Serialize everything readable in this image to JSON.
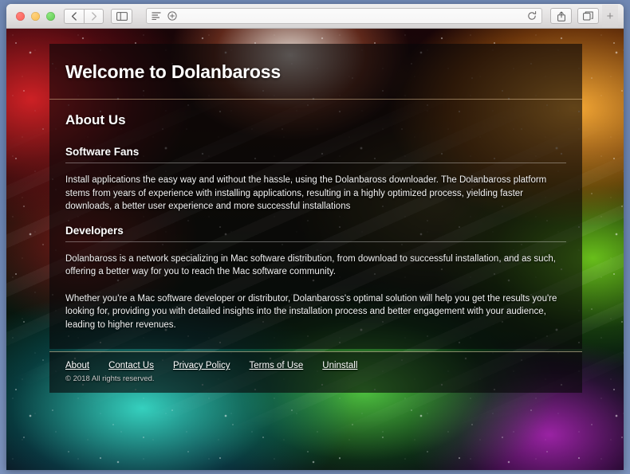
{
  "browser": {
    "traffic_lights": [
      "close",
      "minimize",
      "zoom"
    ],
    "back_label": "Back",
    "forward_label": "Forward",
    "sidebar_label": "Show sidebar",
    "url_value": "",
    "url_placeholder": "",
    "reader_icon": "reader-view-icon",
    "add_icon": "add-bookmark-icon",
    "reload_icon": "reload-icon",
    "share_icon": "share-icon",
    "tabs_icon": "show-all-tabs-icon",
    "new_tab_label": "+"
  },
  "page": {
    "header": {
      "title": "Welcome to Dolanbaross"
    },
    "section_title": "About Us",
    "blocks": [
      {
        "heading": "Software Fans",
        "paragraphs": [
          "Install applications the easy way and without the hassle, using the Dolanbaross downloader. The Dolanbaross platform stems from years of experience with installing applications, resulting in a highly optimized process, yielding faster downloads, a better user experience and more successful installations"
        ]
      },
      {
        "heading": "Developers",
        "paragraphs": [
          "Dolanbaross is a network specializing in Mac software distribution, from download to successful installation, and as such, offering a better way for you to reach the Mac software community.",
          "Whether you're a Mac software developer or distributor, Dolanbaross's optimal solution will help you get the results you're looking for, providing you with detailed insights into the installation process and better engagement with your audience, leading to higher revenues."
        ]
      }
    ],
    "footer": {
      "links": [
        "About",
        "Contact Us",
        "Privacy Policy",
        "Terms of Use",
        "Uninstall"
      ],
      "copyright": "© 2018 All rights reserved."
    }
  },
  "colors": {
    "desktop": "#6c87b6",
    "toolbar": "#e3e1e1",
    "panel_overlay": "rgba(8,6,8,0.62)",
    "text": "#ffffff",
    "copyright_text": "#c9c9c9"
  }
}
